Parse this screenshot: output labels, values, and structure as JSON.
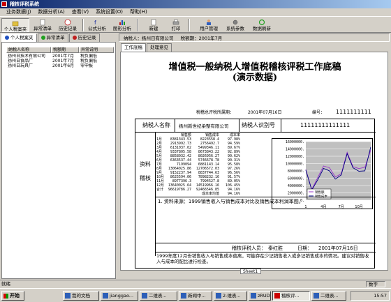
{
  "window": {
    "title": "稽核评税系统"
  },
  "menu": [
    "业务数据(J)",
    "数据分析(A)",
    "查看(V)",
    "系统设置(O)",
    "帮助(H)"
  ],
  "toolbar": {
    "buttons": [
      {
        "label": "个人税案夹",
        "icon": "folder-icon"
      },
      {
        "label": "异常清单",
        "icon": "list-icon"
      },
      {
        "label": "历史记录",
        "icon": "history-icon"
      },
      {
        "label": "公式分析",
        "icon": "formula-icon"
      },
      {
        "label": "图形分析",
        "icon": "chart-icon"
      },
      {
        "label": "新建",
        "icon": "new-icon"
      },
      {
        "label": "打印",
        "icon": "print-icon"
      },
      {
        "label": "用户管理",
        "icon": "user-icon"
      },
      {
        "label": "系统参数",
        "icon": "settings-icon"
      },
      {
        "label": "数据刷新",
        "icon": "refresh-icon"
      }
    ]
  },
  "left": {
    "tabs": [
      "个人税案夹",
      "异常清单",
      "历史记录"
    ],
    "columns": [
      "纳税人名称",
      "税额期",
      "异常说明"
    ],
    "rows": [
      [
        "扬州日技术有限公司",
        "2001年7月",
        "税负偏低"
      ],
      [
        "扬州日食品厂",
        "2001年7月",
        "税负偏低"
      ],
      [
        "扬州日玩具厂",
        "2001年6月",
        "零申报"
      ]
    ]
  },
  "right": {
    "taxpayer_label": "纳税人：扬州日有限公司",
    "period_label": "税额期：2001年7月",
    "tabs": [
      "工作底稿",
      "处理意见"
    ],
    "sheet_tab": "Sheet1"
  },
  "doc": {
    "title1": "增值税一般纳税人增值税稽核评税工作底稿",
    "title2": "(演示数据)",
    "meta_left": "税稽总评税所属期：",
    "meta_date": "2001年07月16日",
    "meta_no_label": "编号：",
    "meta_no": "1111111111",
    "taxpayer_name_label": "纳税人名称",
    "taxpayer_name": "扬州新世纪染整有限公司",
    "taxpayer_id_label": "纳税人识别号",
    "taxpayer_id": "11111111111111",
    "side_label1": "资料",
    "side_label2": "稽核",
    "table_header": [
      "销售额",
      "销售成本",
      "成本率"
    ],
    "table_rows": [
      [
        "1月",
        "8381343.53",
        "8223558.4",
        "97.98%"
      ],
      [
        "2月",
        "2913992.73",
        "2756492.7",
        "94.59%"
      ],
      [
        "3月",
        "6131037.02",
        "5499346.11",
        "89.67%"
      ],
      [
        "4月",
        "9337805.58",
        "8673843.22",
        "92.89%"
      ],
      [
        "5月",
        "8858032.42",
        "8026956.27",
        "90.62%"
      ],
      [
        "6月",
        "6363537.44",
        "5746678.78",
        "90.31%"
      ],
      [
        "7月",
        "7199094",
        "6881143.14",
        "95.58%"
      ],
      [
        "8月",
        "13064025.86",
        "12706572.03",
        "97.26%"
      ],
      [
        "9月",
        "9152237.94",
        "8837744.63",
        "96.56%"
      ],
      [
        "10月",
        "8625594.06",
        "7898232.16",
        "91.57%"
      ],
      [
        "11月",
        "8977396.3",
        "7994527.8",
        "89.05%"
      ],
      [
        "12月",
        "13640025.64",
        "14519966.16",
        "106.45%"
      ],
      [
        "合计",
        "96619786.27",
        "92466546.85",
        "94.16%"
      ]
    ],
    "avg_label": "成本率均值",
    "avg_value": "94.16%",
    "note": "1. 资料来源：1999销售收入与销售成本对比及销售成本利润率图。",
    "reviewer_label": "稽核评税人员：",
    "reviewer": "秦红胜",
    "date_label": "日期：",
    "date": "2001年07月16日",
    "comment": "1999年度12月份销售收入与销售成本偏离，可能存在少记销售收入或多记销售成本的情况。建议对销售收入与成本的配比进行检查。"
  },
  "chart_data": {
    "type": "line",
    "categories": [
      "1月",
      "2月",
      "3月",
      "4月",
      "5月",
      "6月",
      "7月",
      "8月",
      "9月",
      "10月",
      "11月",
      "12月"
    ],
    "x_ticks": [
      "1",
      "4月",
      "7月",
      "10月"
    ],
    "y_ticks": [
      "16000000.",
      "14000000.",
      "12000000.",
      "10000000.",
      "8000000.",
      "6000000.",
      "4000000.",
      "2000000.",
      "0."
    ],
    "ylim": [
      0,
      16000000
    ],
    "series": [
      {
        "name": "销售额",
        "color": "#9933cc",
        "values": [
          8381343.53,
          2913992.73,
          6131037.02,
          9337805.58,
          8858032.42,
          6363537.44,
          7199094,
          13064025.86,
          9152237.94,
          8625594.06,
          8977396.3,
          13640025.64
        ]
      },
      {
        "name": "销售成本",
        "color": "#000080",
        "values": [
          8223558.4,
          2756492.7,
          5499346.11,
          8673843.22,
          8026956.27,
          5746678.78,
          6881143.14,
          12706572.03,
          8837744.63,
          7898232.16,
          7994527.8,
          14519966.16
        ]
      }
    ],
    "grid": true,
    "legend": "bottom-left"
  },
  "status": {
    "left": "就绪",
    "numlock": "数字"
  },
  "taskbar": {
    "start": "开始",
    "tasks": [
      "我的文档",
      "jianggao...",
      "二维表...",
      "新闻中...",
      "2-维表...",
      "zRUD",
      "稽核评...",
      "二维表..."
    ],
    "clock": "15:57"
  }
}
